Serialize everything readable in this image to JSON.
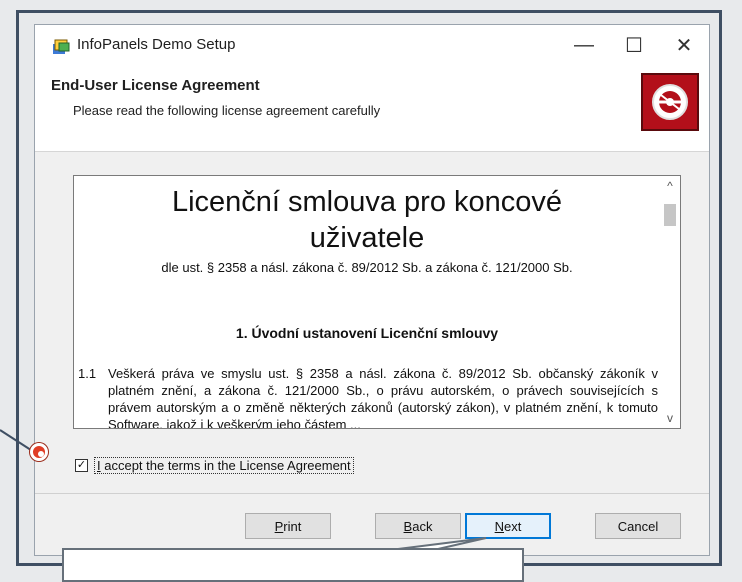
{
  "window": {
    "title": "InfoPanels Demo Setup",
    "minimize_glyph": "—",
    "maximize_glyph": "☐",
    "close_glyph": "✕"
  },
  "header": {
    "title": "End-User License Agreement",
    "subtitle": "Please read the following license agreement carefully"
  },
  "license": {
    "title_line1": "Licenční smlouva pro koncové",
    "title_line2": "uživatele",
    "subtitle": "dle ust. § 2358 a násl. zákona č. 89/2012 Sb. a zákona č. 121/2000 Sb.",
    "section_heading": "1. Úvodní ustanovení Licenční smlouvy",
    "paragraph_number": "1.1",
    "paragraph_text": "Veškerá práva ve smyslu ust. § 2358 a násl. zákona č. 89/2012 Sb. občanský zákoník v platném znění, a zákona č. 121/2000 Sb., o právu autorském, o právech souvisejících s právem autorským a o změně některých zákonů (autorský zákon), v platném znění, k tomuto Software, jakož i k veškerým jeho částem ..."
  },
  "scrollbar": {
    "up_glyph": "^",
    "down_glyph": "v"
  },
  "accept": {
    "checked": true,
    "check_glyph": "✓",
    "label_first": "I",
    "label_rest": " accept the terms in the License Agreement"
  },
  "buttons": {
    "print": {
      "first": "P",
      "rest": "rint"
    },
    "back": {
      "first": "B",
      "rest": "ack"
    },
    "next": {
      "first": "N",
      "rest": "ext"
    },
    "cancel": "Cancel"
  },
  "colors": {
    "accent": "#0078d7",
    "logo_red": "#b30f1a",
    "marker": "#e03d26",
    "outer_border": "#3f4f63"
  },
  "icons": {
    "title": "setup-package-icon",
    "logo": "disc-icon",
    "marker": "pointer-marker-icon"
  }
}
